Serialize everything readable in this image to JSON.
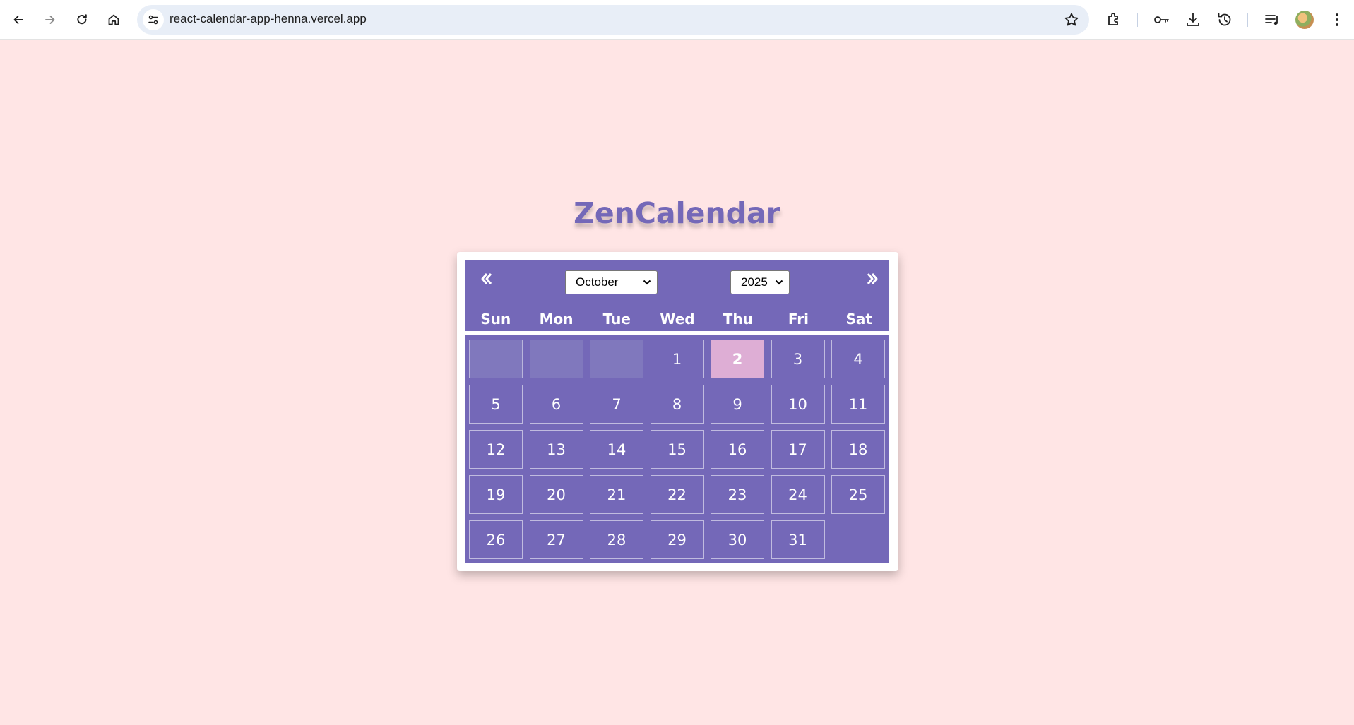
{
  "browser": {
    "url": "react-calendar-app-henna.vercel.app",
    "icons": [
      "back-icon",
      "forward-icon",
      "reload-icon",
      "home-icon",
      "site-info-icon",
      "bookmark-star-icon",
      "extensions-icon",
      "password-key-icon",
      "download-icon",
      "history-icon",
      "media-control-icon",
      "profile-avatar",
      "menu-icon"
    ]
  },
  "app": {
    "title": "ZenCalendar"
  },
  "calendar": {
    "month": "October",
    "year": "2025",
    "weekdays": [
      "Sun",
      "Mon",
      "Tue",
      "Wed",
      "Thu",
      "Fri",
      "Sat"
    ],
    "leading_blank_days": 3,
    "days": [
      "1",
      "2",
      "3",
      "4",
      "5",
      "6",
      "7",
      "8",
      "9",
      "10",
      "11",
      "12",
      "13",
      "14",
      "15",
      "16",
      "17",
      "18",
      "19",
      "20",
      "21",
      "22",
      "23",
      "24",
      "25",
      "26",
      "27",
      "28",
      "29",
      "30",
      "31"
    ],
    "today": "2",
    "colors": {
      "page_background": "#ffe5e5",
      "accent": "#7468b8",
      "today_highlight": "#deaed5",
      "blank_cell": "#8078bd"
    }
  }
}
